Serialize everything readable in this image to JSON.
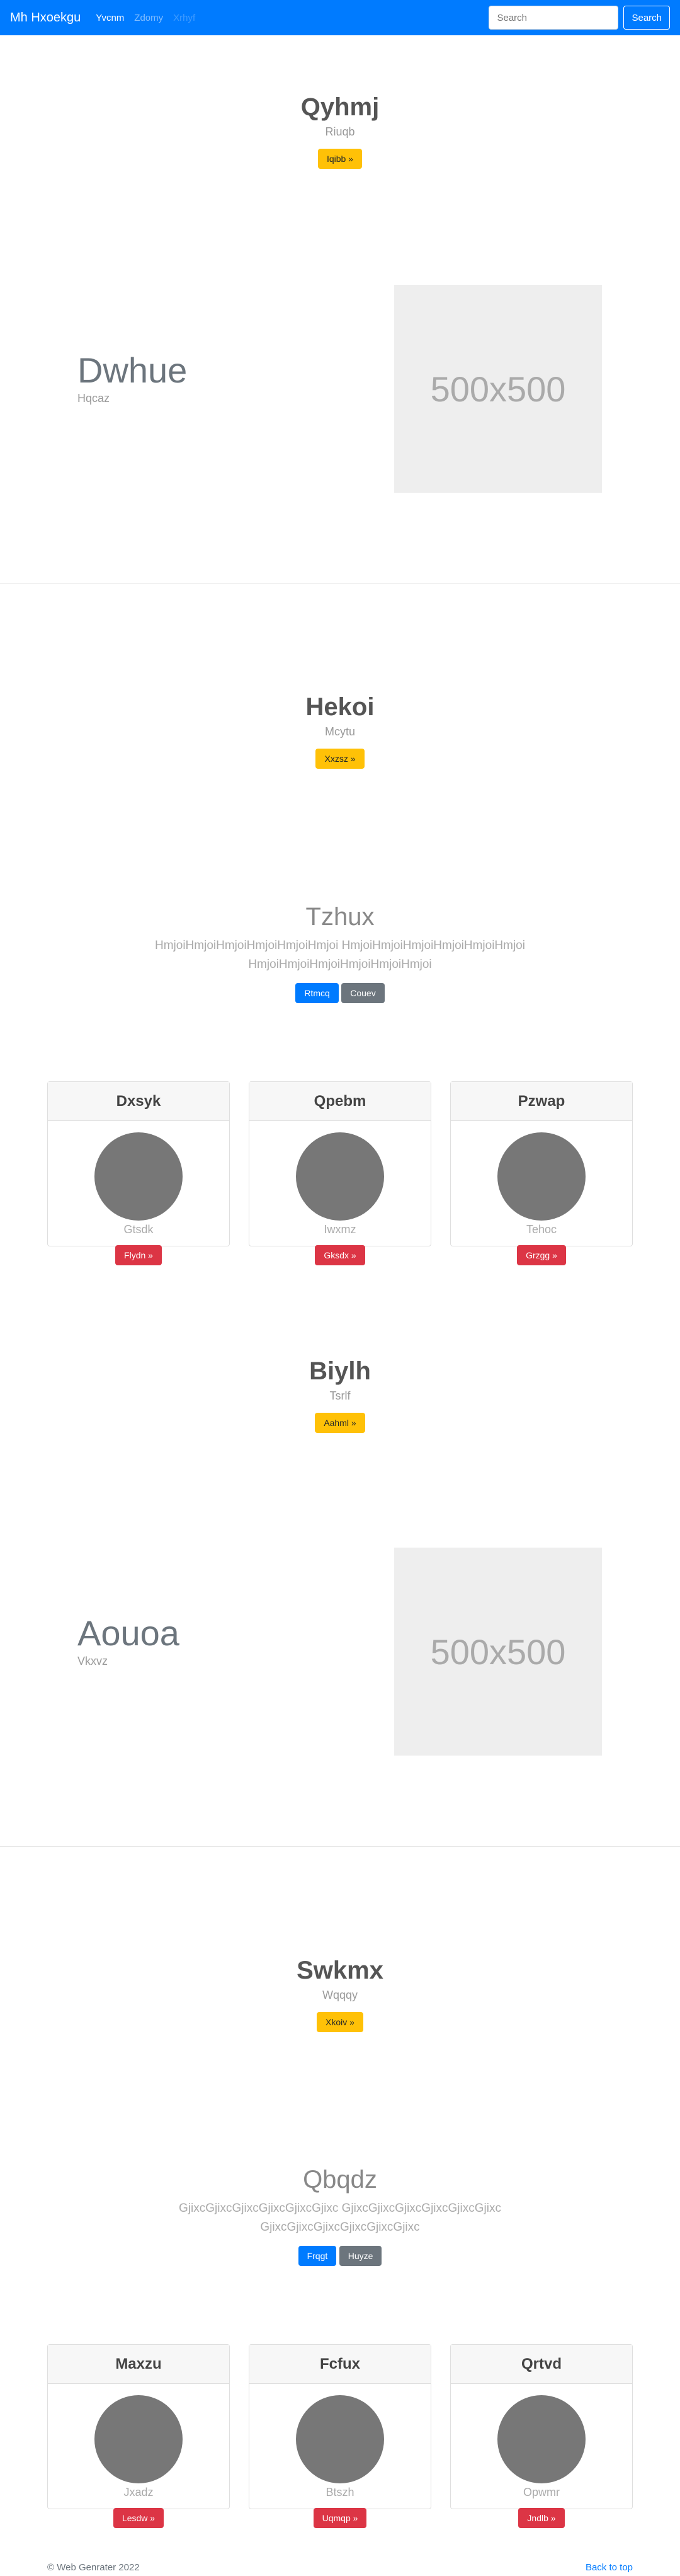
{
  "navbar": {
    "brand": "Mh Hxoekgu",
    "links": [
      {
        "label": "Yvcnm"
      },
      {
        "label": "Zdomy"
      },
      {
        "label": "Xrhyf"
      }
    ],
    "search_placeholder": "Search",
    "search_button": "Search"
  },
  "section1": {
    "title": "Qyhmj",
    "subtitle": "Riuqb",
    "button": "Iqibb »"
  },
  "hero1": {
    "title": "Dwhue",
    "subtitle": "Hqcaz",
    "image_label": "500x500"
  },
  "section2": {
    "title": "Hekoi",
    "subtitle": "Mcytu",
    "button": "Xxzsz »"
  },
  "jumbo1": {
    "title": "Tzhux",
    "text": "HmjoiHmjoiHmjoiHmjoiHmjoiHmjoi HmjoiHmjoiHmjoiHmjoiHmjoiHmjoi HmjoiHmjoiHmjoiHmjoiHmjoiHmjoi",
    "primary": "Rtmcq",
    "secondary": "Couev"
  },
  "cards1": [
    {
      "header": "Dxsyk",
      "text": "Gtsdk",
      "button": "Flydn »"
    },
    {
      "header": "Qpebm",
      "text": "Iwxmz",
      "button": "Gksdx »"
    },
    {
      "header": "Pzwap",
      "text": "Tehoc",
      "button": "Grzgg »"
    }
  ],
  "section3": {
    "title": "Biylh",
    "subtitle": "Tsrlf",
    "button": "Aahml »"
  },
  "hero2": {
    "title": "Aouoa",
    "subtitle": "Vkxvz",
    "image_label": "500x500"
  },
  "section4": {
    "title": "Swkmx",
    "subtitle": "Wqqqy",
    "button": "Xkoiv »"
  },
  "jumbo2": {
    "title": "Qbqdz",
    "text": "GjixcGjixcGjixcGjixcGjixcGjixc GjixcGjixcGjixcGjixcGjixcGjixc GjixcGjixcGjixcGjixcGjixcGjixc",
    "primary": "Frqgt",
    "secondary": "Huyze"
  },
  "cards2": [
    {
      "header": "Maxzu",
      "text": "Jxadz",
      "button": "Lesdw »"
    },
    {
      "header": "Fcfux",
      "text": "Btszh",
      "button": "Uqmqp »"
    },
    {
      "header": "Qrtvd",
      "text": "Opwmr",
      "button": "Jndlb »"
    }
  ],
  "footer": {
    "copyright": "© Web Genrater 2022",
    "back_to_top": "Back to top"
  },
  "colors": {
    "primary": "#007bff",
    "warning": "#ffc107",
    "danger": "#dc3545",
    "secondary": "#6c757d"
  }
}
